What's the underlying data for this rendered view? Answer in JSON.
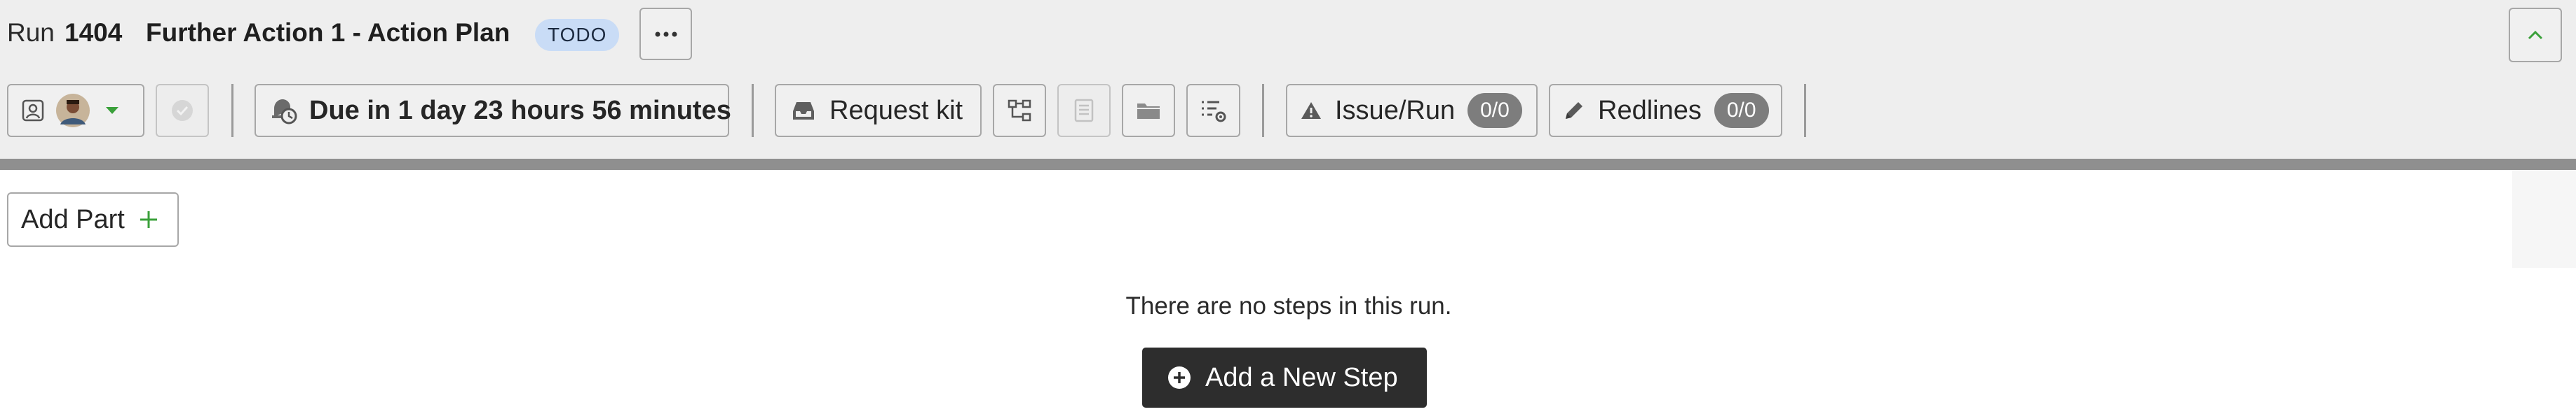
{
  "header": {
    "run_label": "Run",
    "run_number": "1404",
    "title": "Further Action 1 - Action Plan",
    "status": "TODO",
    "more_icon": "ellipsis-icon",
    "collapse_icon": "chevron-up-icon"
  },
  "toolbar": {
    "assignee_icon": "contact-card-icon",
    "assignee_avatar": "user-avatar",
    "assignee_dropdown_icon": "caret-down-icon",
    "complete_icon": "check-circle-icon",
    "due": {
      "icon": "bell-clock-icon",
      "label": "Due in 1 day 23 hours 56 minutes"
    },
    "request_kit": {
      "icon": "inbox-icon",
      "label": "Request kit"
    },
    "workflow_icon": "flow-diagram-icon",
    "document_icon": "document-icon",
    "folder_icon": "folder-icon",
    "settings_list_icon": "list-settings-icon",
    "issue_run": {
      "icon": "warning-triangle-icon",
      "label": "Issue/Run",
      "count": "0/0"
    },
    "redlines": {
      "icon": "pencil-icon",
      "label": "Redlines",
      "count": "0/0"
    }
  },
  "main": {
    "add_part_label": "Add Part",
    "empty_message": "There are no steps in this run.",
    "add_step_label": "Add a New Step"
  },
  "colors": {
    "header_bg": "#eeeeee",
    "status_badge_bg": "#c9dcf6",
    "accent_green": "#3aa03a",
    "primary_button_bg": "#2d2d2d",
    "count_pill_bg": "#7d7d7d"
  }
}
